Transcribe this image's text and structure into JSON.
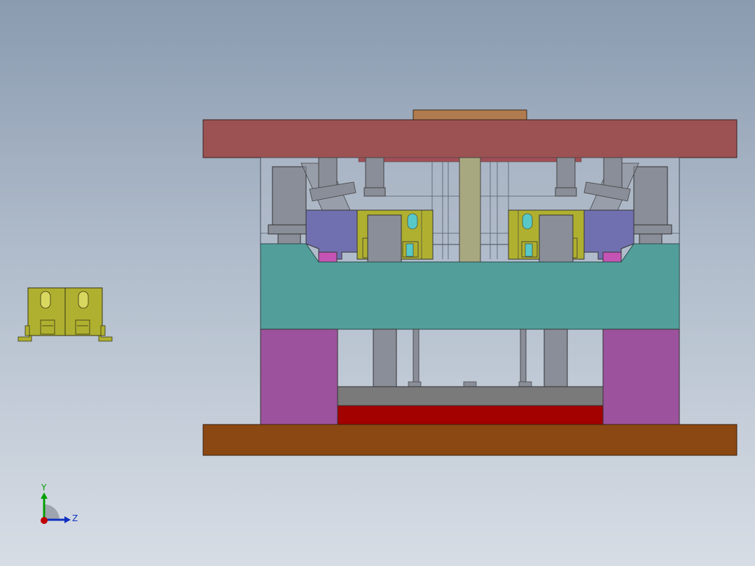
{
  "viewport": {
    "background_top": "#8a9bb0",
    "background_bottom": "#d7dde5"
  },
  "mold_assembly": {
    "colors": {
      "top_clamp_plate": "#9c5252",
      "sprue_bushing": "#b07b4e",
      "a_plate": "#b0bac8",
      "cavity_plate": "#529e9b",
      "support_block": "#9c529c",
      "ejector_retainer": "#7a7a7a",
      "ejector_plate": "#a30000",
      "bottom_clamp_plate": "#8b4812",
      "slider_block": "#7070b0",
      "insert": "#b0b030",
      "pin": "#8a8e98",
      "guide_pillar": "#a8a880",
      "wedge_pink": "#c454b4"
    }
  },
  "part_preview": {
    "color": "#b0b030",
    "outline_color": "#333311"
  },
  "triad": {
    "y_label": "Y",
    "z_label": "Z",
    "y_color": "#00a000",
    "z_color": "#1030c0",
    "x_color": "#c00000"
  }
}
